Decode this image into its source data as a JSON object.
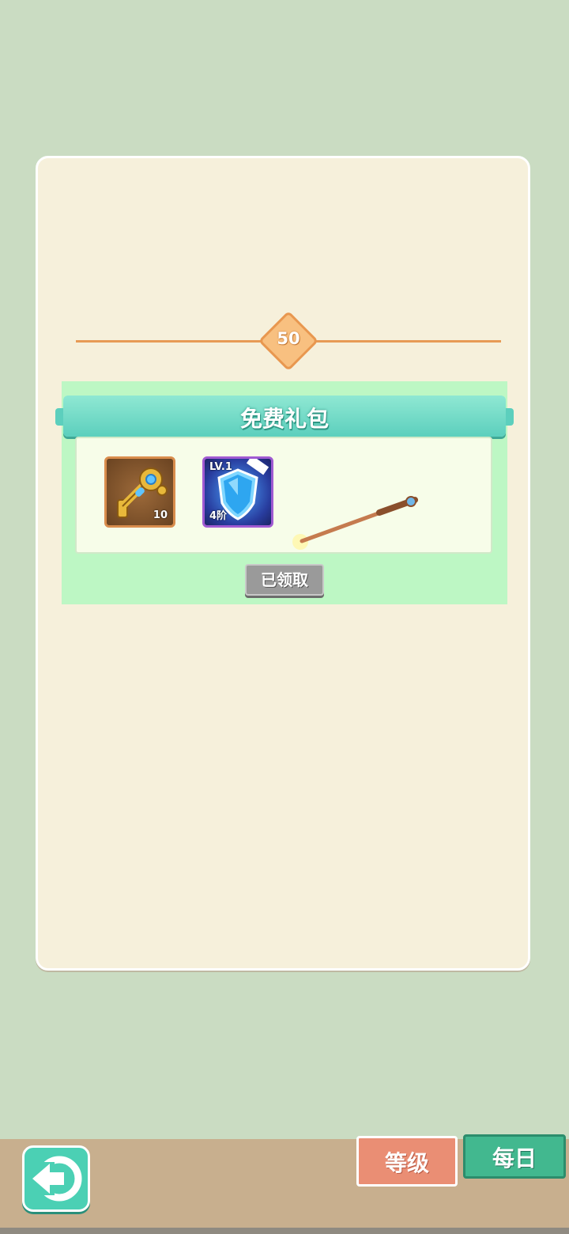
{
  "level": {
    "value": "50"
  },
  "gift": {
    "title": "免费礼包",
    "items": [
      {
        "name": "golden-key",
        "count": "10",
        "frame_color": "#d98d4d"
      },
      {
        "name": "shield",
        "level": "LV.1",
        "tier": "4阶",
        "frame_color": "#a05ad2"
      }
    ],
    "status_button": "已领取"
  },
  "bottom_nav": {
    "tabs": [
      {
        "label": "等级",
        "active": true
      },
      {
        "label": "每日",
        "active": false
      }
    ],
    "back_icon": "back-arrow-icon"
  },
  "colors": {
    "background": "#cadcc2",
    "panel": "#f6f0db",
    "gift_header": "#5ccfbd",
    "gift_box": "#bdf7c4",
    "accent_orange": "#e79a55",
    "tab_level": "#ea8e74",
    "tab_daily": "#42b88f"
  }
}
